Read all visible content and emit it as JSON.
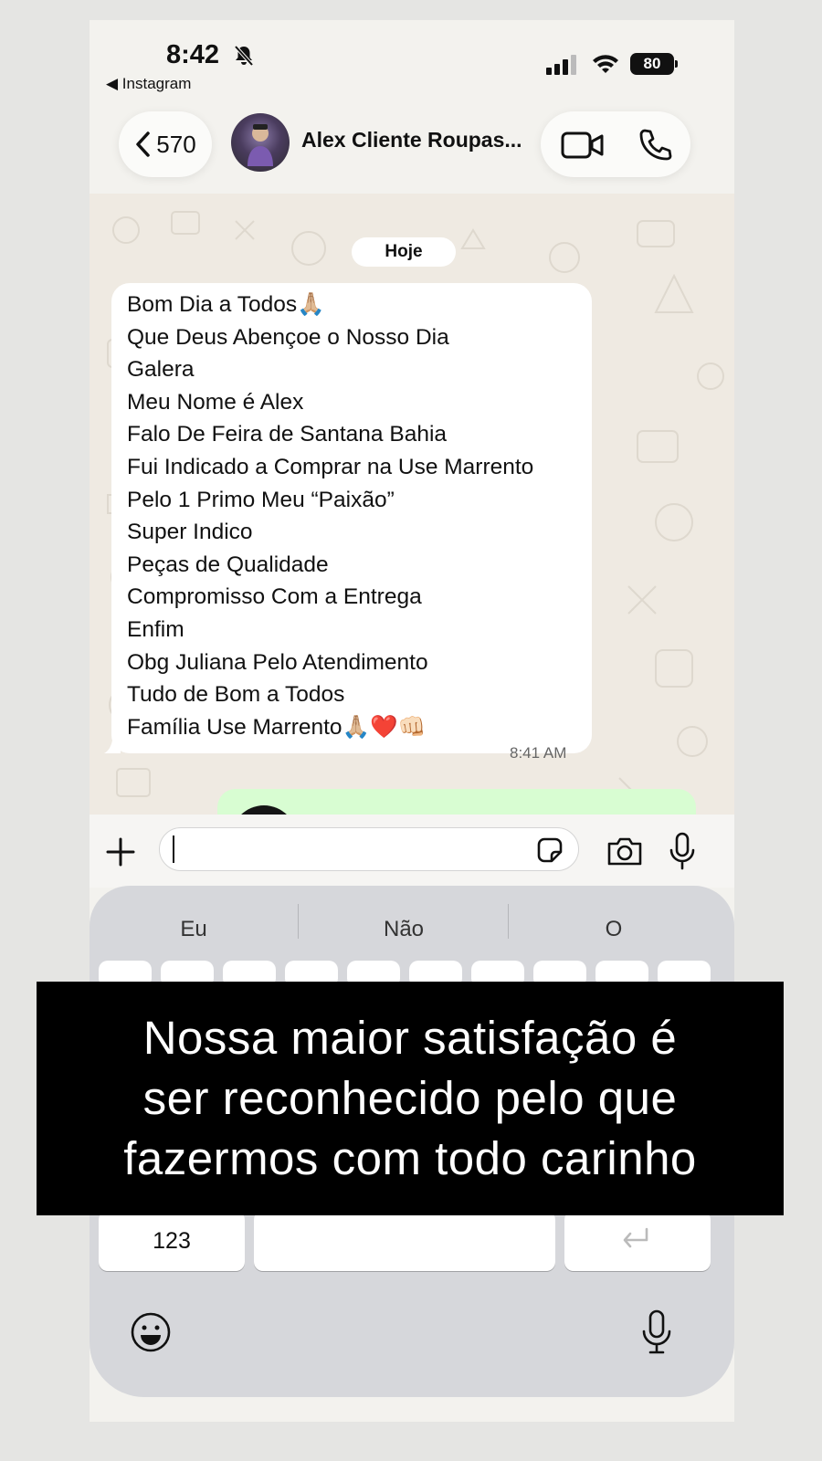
{
  "status_bar": {
    "time": "8:42",
    "back_app": "◀ Instagram",
    "battery": "80"
  },
  "header": {
    "back_count": "570",
    "contact_name": "Alex Cliente Roupas...",
    "icons": [
      "chevron-left-icon",
      "video-call-icon",
      "phone-call-icon"
    ]
  },
  "chat": {
    "date_label": "Hoje",
    "message": {
      "lines": [
        "Bom Dia a Todos🙏🏼",
        "Que Deus Abençoe o Nosso Dia",
        "Galera",
        "Meu Nome é Alex",
        "Falo De Feira de Santana Bahia",
        "Fui Indicado a Comprar na Use Marrento",
        "Pelo 1 Primo Meu “Paixão”",
        "Super Indico",
        "Peças de Qualidade",
        "Compromisso Com a Entrega",
        "Enfim",
        "Obg Juliana Pelo Atendimento",
        "Tudo de Bom a Todos",
        "Família Use Marrento🙏🏼❤️👊🏻"
      ],
      "time": "8:41 AM"
    }
  },
  "input": {
    "value": "",
    "icons": [
      "plus-icon",
      "sticker-icon",
      "camera-icon",
      "mic-icon"
    ]
  },
  "keyboard": {
    "suggestions": [
      "Eu",
      "Não",
      "O"
    ],
    "numbers_key": "123",
    "icons": [
      "return-icon",
      "emoji-icon",
      "dictation-mic-icon"
    ]
  },
  "caption": {
    "lines": [
      "Nossa maior satisfação é",
      "ser reconhecido pelo que",
      "fazermos com todo carinho"
    ]
  },
  "colors": {
    "chat_background": "#efeae2",
    "incoming_bubble": "#ffffff",
    "outgoing_bubble": "#d8fdd2",
    "keyboard": "#d6d7db",
    "caption_background": "#000000",
    "caption_text": "#ffffff"
  }
}
